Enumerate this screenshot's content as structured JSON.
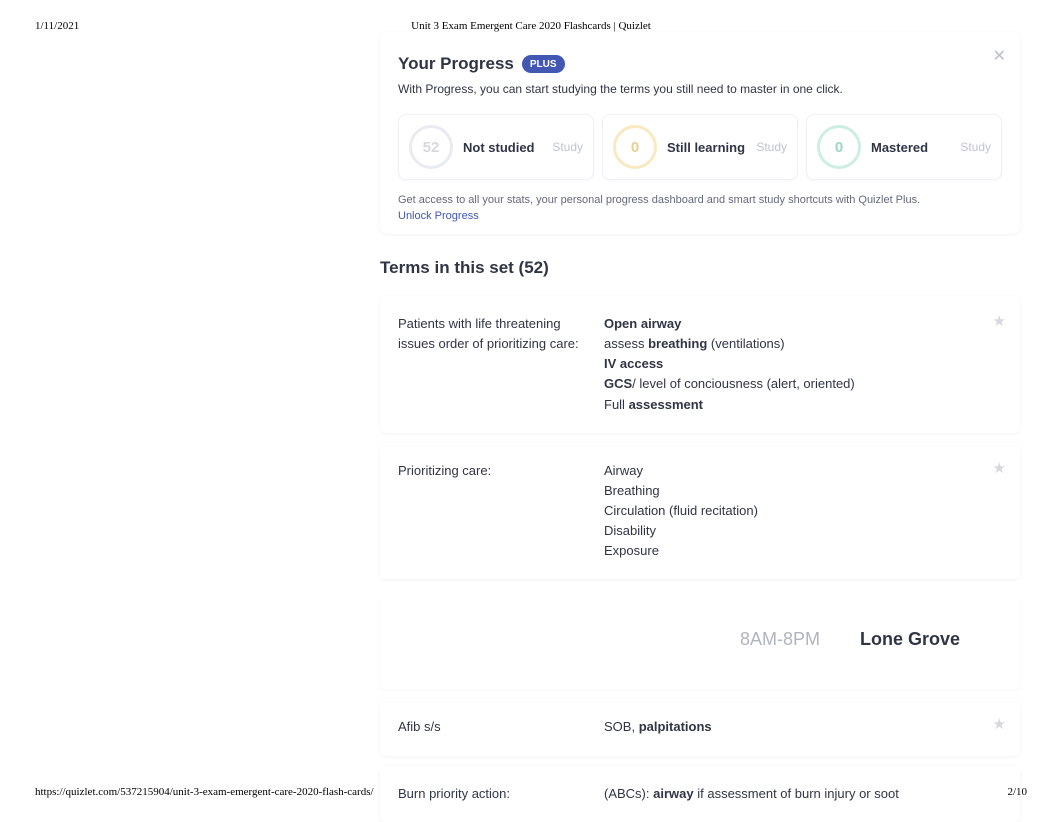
{
  "header": {
    "date": "1/11/2021",
    "title": "Unit 3 Exam Emergent Care 2020 Flashcards | Quizlet"
  },
  "progress": {
    "title": "Your Progress",
    "badge": "PLUS",
    "subtitle": "With Progress, you can start studying the terms you still need to master in one click.",
    "cards": [
      {
        "num": "52",
        "label": "Not studied",
        "action": "Study"
      },
      {
        "num": "0",
        "label": "Still learning",
        "action": "Study"
      },
      {
        "num": "0",
        "label": "Mastered",
        "action": "Study"
      }
    ],
    "upsell": "Get access to all your stats, your personal progress dashboard and smart study shortcuts with Quizlet Plus.",
    "unlock": "Unlock Progress"
  },
  "terms": {
    "heading": "Terms in this set (52)",
    "rows": [
      {
        "term": "Patients with life threatening issues order of prioritizing care:",
        "def_html": "<b>Open airway</b><br>assess <b>breathing</b> (ventilations)<br><b>IV access</b><br><b>GCS</b>/ level of conciousness (alert, oriented)<br>Full <b>assessment</b>"
      },
      {
        "term": "Prioritizing care:",
        "def_html": "Airway<br>Breathing<br>Circulation (fluid recitation)<br>Disability<br>Exposure"
      },
      {
        "term": "Afib s/s",
        "def_html": "SOB, <b>palpitations</b>"
      },
      {
        "term": "Burn priority action:",
        "def_html": "(ABCs): <b>airway</b> if assessment of burn injury or soot"
      }
    ]
  },
  "ad": {
    "hours": "8AM-8PM",
    "location": "Lone Grove"
  },
  "footer": {
    "url": "https://quizlet.com/537215904/unit-3-exam-emergent-care-2020-flash-cards/",
    "page": "2/10"
  }
}
